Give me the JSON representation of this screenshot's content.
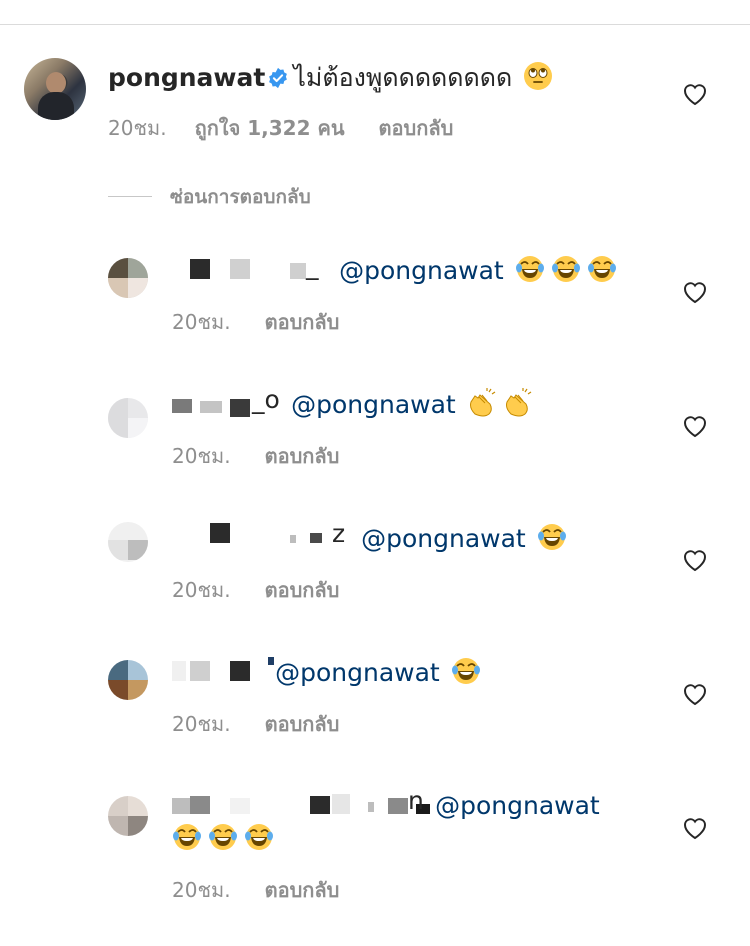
{
  "main_comment": {
    "username": "pongnawat",
    "text": "ไม่ต้องพูดดดดดดดด",
    "emoji": "🙄",
    "time": "20ชม.",
    "likes": "ถูกใจ 1,322 คน",
    "reply_label": "ตอบกลับ"
  },
  "hide_replies_label": "ซ่อนการตอบกลับ",
  "replies": [
    {
      "username_visible": "_",
      "mention": "@pongnawat",
      "emojis": "😂😂😂",
      "time": "20ชม.",
      "reply_label": "ตอบกลับ"
    },
    {
      "username_visible": "_o",
      "mention": "@pongnawat",
      "emojis": "👏👏",
      "time": "20ชม.",
      "reply_label": "ตอบกลับ"
    },
    {
      "username_visible": "z",
      "mention": "@pongnawat",
      "emojis": "😂",
      "time": "20ชม.",
      "reply_label": "ตอบกลับ"
    },
    {
      "username_visible": "",
      "mention": "@pongnawat",
      "emojis": "😂",
      "time": "20ชม.",
      "reply_label": "ตอบกลับ"
    },
    {
      "username_visible": "n",
      "mention": "@pongnawat",
      "emojis": "😂😂😂",
      "time": "20ชม.",
      "reply_label": "ตอบกลับ"
    }
  ],
  "colors": {
    "mention": "#00376b",
    "meta": "#8e8e8e",
    "verified": "#3897f0"
  }
}
